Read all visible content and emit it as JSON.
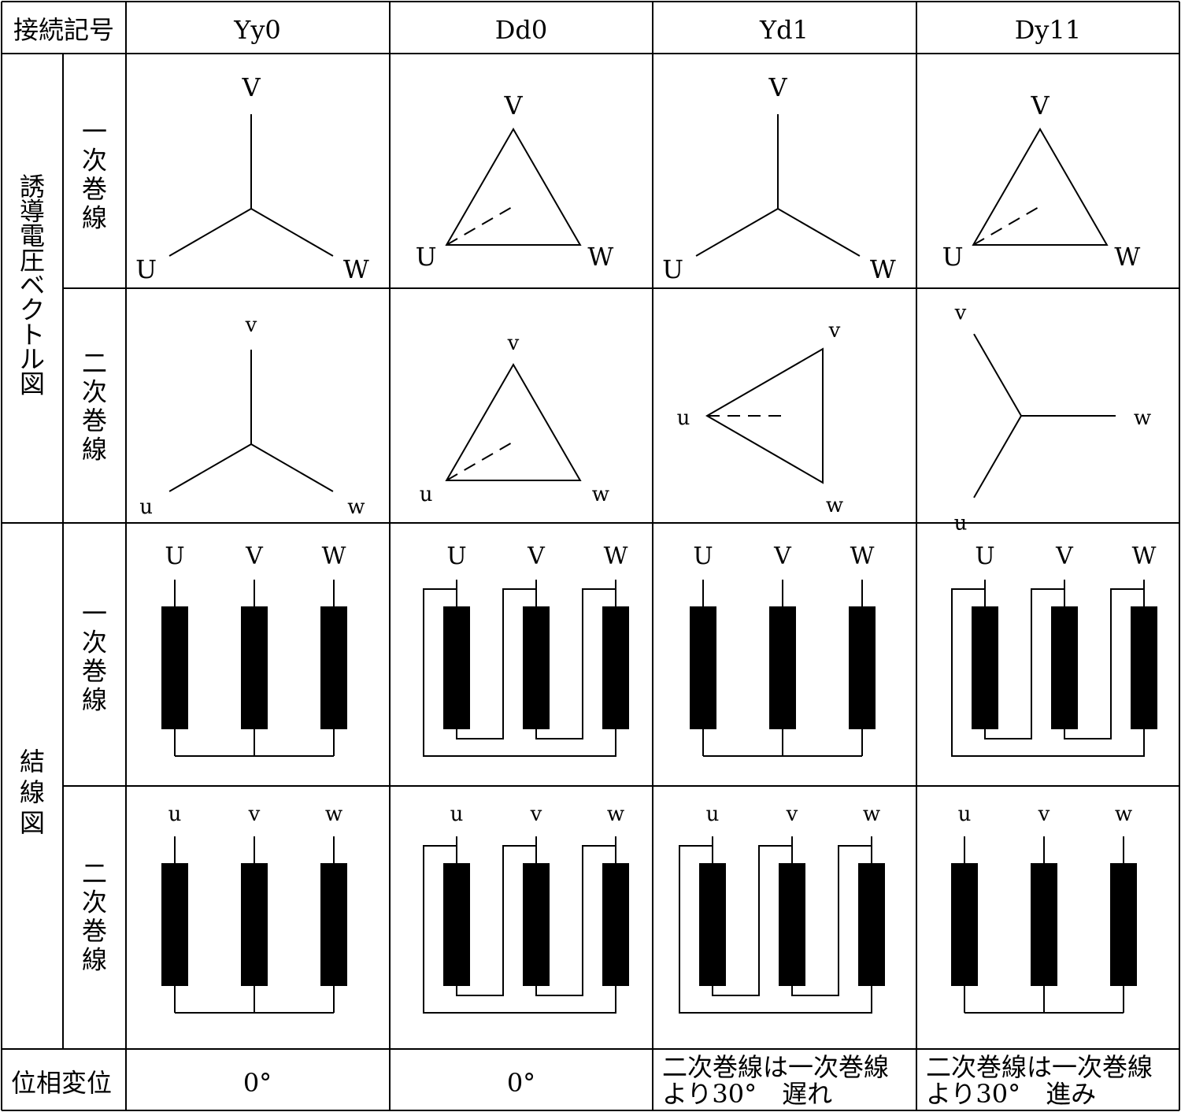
{
  "header": {
    "corner": "接続記号",
    "columns": [
      "Yy0",
      "Dd0",
      "Yd1",
      "Dy11"
    ]
  },
  "row_labels": {
    "vector_diagram": "誘導電圧ベクトル図",
    "wiring_diagram": "結線図",
    "primary": "一次巻線",
    "secondary": "二次巻線",
    "phase_shift": "位相変位"
  },
  "phase_shift_values": [
    [
      "0°"
    ],
    [
      "0°"
    ],
    [
      "二次巻線は一次巻線",
      "より30°　遅れ"
    ],
    [
      "二次巻線は一次巻線",
      "より30°　進み"
    ]
  ],
  "vector_diagrams": [
    {
      "primary": {
        "shape": "star",
        "labels": [
          "U",
          "V",
          "W"
        ]
      },
      "secondary": {
        "shape": "star",
        "labels": [
          "u",
          "v",
          "w"
        ]
      }
    },
    {
      "primary": {
        "shape": "delta",
        "labels": [
          "U",
          "V",
          "W"
        ]
      },
      "secondary": {
        "shape": "delta",
        "labels": [
          "u",
          "v",
          "w"
        ]
      }
    },
    {
      "primary": {
        "shape": "star",
        "labels": [
          "U",
          "V",
          "W"
        ]
      },
      "secondary": {
        "shape": "delta-rotated",
        "labels": [
          "u",
          "v",
          "w"
        ]
      }
    },
    {
      "primary": {
        "shape": "delta",
        "labels": [
          "U",
          "V",
          "W"
        ]
      },
      "secondary": {
        "shape": "star-rotated",
        "labels": [
          "u",
          "v",
          "w"
        ]
      }
    }
  ],
  "wiring_diagrams": [
    {
      "primary": {
        "type": "star",
        "labels": [
          "U",
          "V",
          "W"
        ]
      },
      "secondary": {
        "type": "star",
        "labels": [
          "u",
          "v",
          "w"
        ]
      }
    },
    {
      "primary": {
        "type": "delta",
        "labels": [
          "U",
          "V",
          "W"
        ]
      },
      "secondary": {
        "type": "delta",
        "labels": [
          "u",
          "v",
          "w"
        ]
      }
    },
    {
      "primary": {
        "type": "star",
        "labels": [
          "U",
          "V",
          "W"
        ]
      },
      "secondary": {
        "type": "delta",
        "labels": [
          "u",
          "v",
          "w"
        ]
      }
    },
    {
      "primary": {
        "type": "delta",
        "labels": [
          "U",
          "V",
          "W"
        ]
      },
      "secondary": {
        "type": "star",
        "labels": [
          "u",
          "v",
          "w"
        ]
      }
    }
  ]
}
